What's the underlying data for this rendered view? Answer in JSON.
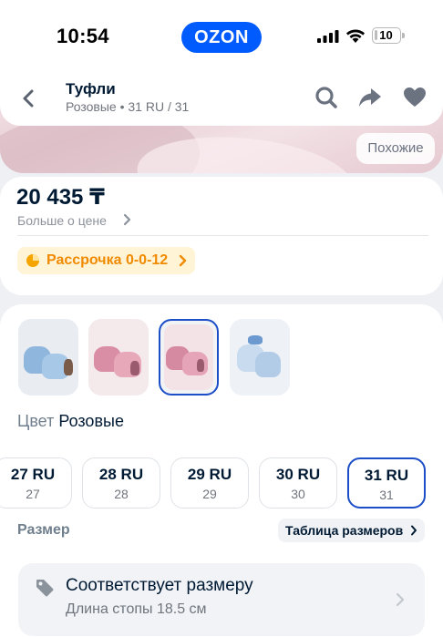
{
  "status_bar": {
    "time": "10:54",
    "brand": "OZON",
    "battery": "10",
    "battery_level": 0.1
  },
  "header": {
    "title": "Туфли",
    "subtitle": "Розовые • 31 RU / 31",
    "icons": [
      "back-arrow-icon",
      "search-icon",
      "share-icon",
      "heart-icon"
    ]
  },
  "hero": {
    "similar_label": "Похожие"
  },
  "price": {
    "value": "20 435 ₸",
    "more_label": "Больше о цене",
    "installment_label": "Рассрочка 0-0-12"
  },
  "variants": {
    "thumbnails": [
      {
        "name": "blue"
      },
      {
        "name": "pink"
      },
      {
        "name": "pink",
        "selected": true
      },
      {
        "name": "light-blue"
      }
    ],
    "color_label": "Цвет",
    "color_value": "Розовые",
    "sizes": [
      {
        "main": "27 RU",
        "sub": "27"
      },
      {
        "main": "28 RU",
        "sub": "28"
      },
      {
        "main": "29 RU",
        "sub": "29"
      },
      {
        "main": "30 RU",
        "sub": "30"
      },
      {
        "main": "31 RU",
        "sub": "31",
        "selected": true
      }
    ],
    "size_label": "Размер",
    "size_table_label": "Таблица размеров"
  },
  "fit": {
    "title": "Соответствует размеру",
    "subtitle": "Длина стопы 18.5 см"
  },
  "colors": {
    "brand_blue": "#005bff",
    "selected_border": "#1c4ec8",
    "installment_bg": "#fff4d6",
    "installment_text": "#f08a00"
  }
}
